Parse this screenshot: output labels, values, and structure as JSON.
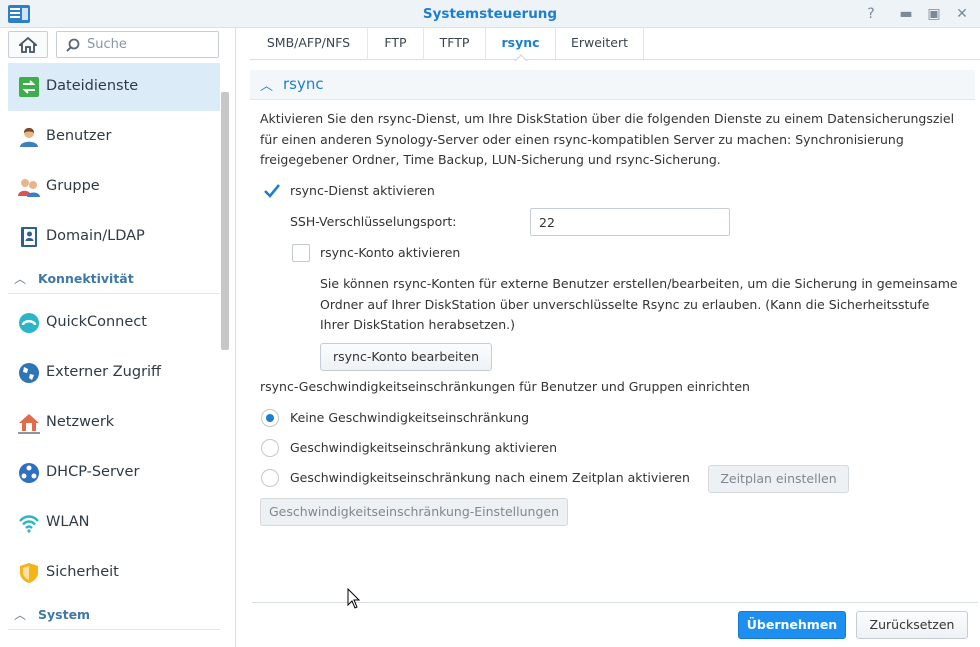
{
  "window": {
    "title": "Systemsteuerung",
    "controls": [
      "help",
      "pin",
      "maximize",
      "close"
    ]
  },
  "sidebar": {
    "search_placeholder": "Suche",
    "items": [
      {
        "label": "Dateidienste",
        "icon": "file-services-icon",
        "active": true
      },
      {
        "label": "Benutzer",
        "icon": "user-icon"
      },
      {
        "label": "Gruppe",
        "icon": "group-icon"
      },
      {
        "label": "Domain/LDAP",
        "icon": "domain-ldap-icon"
      }
    ],
    "section_connectivity": "Konnektivität",
    "connectivity_items": [
      {
        "label": "QuickConnect",
        "icon": "quickconnect-icon"
      },
      {
        "label": "Externer Zugriff",
        "icon": "globe-icon"
      },
      {
        "label": "Netzwerk",
        "icon": "network-home-icon"
      },
      {
        "label": "DHCP-Server",
        "icon": "dhcp-server-icon"
      },
      {
        "label": "WLAN",
        "icon": "wifi-icon"
      },
      {
        "label": "Sicherheit",
        "icon": "shield-icon"
      }
    ],
    "section_system": "System"
  },
  "tabs": [
    "SMB/AFP/NFS",
    "FTP",
    "TFTP",
    "rsync",
    "Erweitert"
  ],
  "active_tab": "rsync",
  "panel": {
    "title": "rsync",
    "description": "Aktivieren Sie den rsync-Dienst, um Ihre DiskStation über die folgenden Dienste zu einem Datensicherungsziel für einen anderen Synology-Server oder einen rsync-kompatiblen Server zu machen: Synchronisierung freigegebener Ordner, Time Backup, LUN-Sicherung und rsync-Sicherung.",
    "enable_rsync_label": "rsync-Dienst aktivieren",
    "enable_rsync_checked": true,
    "ssh_port_label": "SSH-Verschlüsselungsport:",
    "ssh_port_value": "22",
    "rsync_account_label": "rsync-Konto aktivieren",
    "rsync_account_checked": false,
    "rsync_account_desc": "Sie können rsync-Konten für externe Benutzer erstellen/bearbeiten, um die Sicherung in gemeinsame Ordner auf Ihrer DiskStation über unverschlüsselte Rsync zu erlauben. (Kann die Sicherheitsstufe Ihrer DiskStation herabsetzen.)",
    "edit_account_button": "rsync-Konto bearbeiten",
    "speed_limit_heading": "rsync-Geschwindigkeitseinschränkungen für Benutzer und Gruppen einrichten",
    "radio_options": [
      "Keine Geschwindigkeitseinschränkung",
      "Geschwindigkeitseinschränkung aktivieren",
      "Geschwindigkeitseinschränkung nach einem Zeitplan aktivieren"
    ],
    "radio_selected_index": 0,
    "schedule_button": "Zeitplan einstellen",
    "speed_settings_button": "Geschwindigkeitseinschränkung-Einstellungen"
  },
  "footer": {
    "apply_button": "Übernehmen",
    "reset_button": "Zurücksetzen"
  },
  "colors": {
    "accent": "#1d7fcf",
    "primary_button": "#1d8ff0",
    "active_nav_bg": "#dcebf8"
  }
}
